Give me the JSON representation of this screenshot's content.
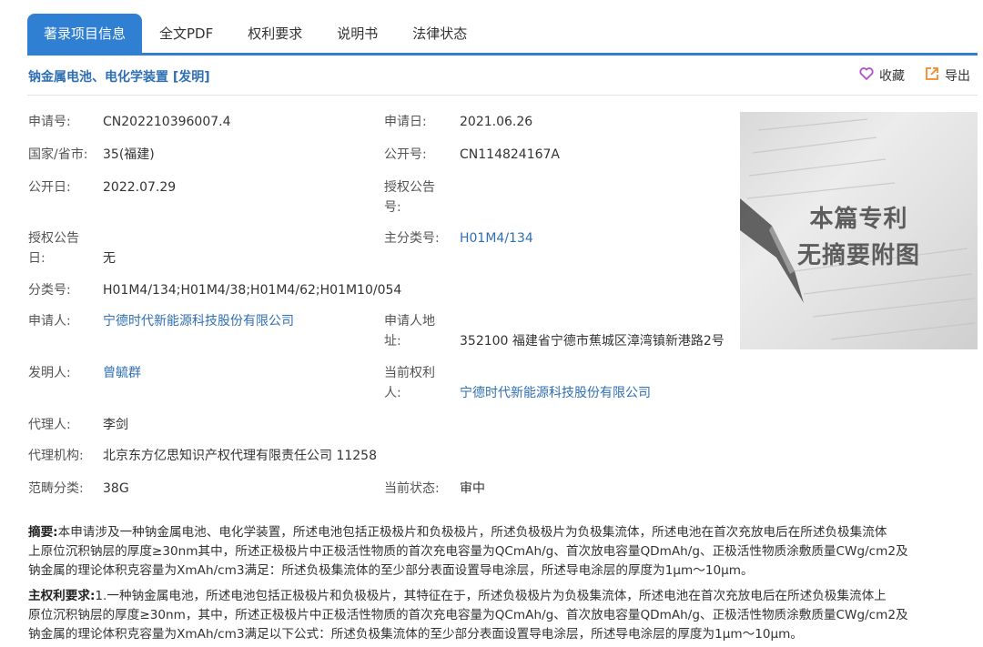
{
  "tabs": [
    {
      "label": "著录项目信息",
      "active": true
    },
    {
      "label": "全文PDF"
    },
    {
      "label": "权利要求"
    },
    {
      "label": "说明书"
    },
    {
      "label": "法律状态"
    }
  ],
  "title": "钠金属电池、电化学装置 [发明]",
  "actions": {
    "favorite": "收藏",
    "export": "导出"
  },
  "fields": {
    "app_no_label": "申请号:",
    "app_no": "CN202210396007.4",
    "app_date_label": "申请日:",
    "app_date": "2021.06.26",
    "country_label": "国家/省市:",
    "country": "35(福建)",
    "pub_no_label": "公开号:",
    "pub_no": "CN114824167A",
    "pub_date_label": "公开日:",
    "pub_date": "2022.07.29",
    "grant_no_label_1": "授权公告",
    "grant_no_label_2": "号:",
    "grant_date_label_1": "授权公告",
    "grant_date_label_2": "日:",
    "grant_date": "无",
    "main_class_label": "主分类号:",
    "main_class": "H01M4/134",
    "class_label": "分类号:",
    "class": "H01M4/134;H01M4/38;H01M4/62;H01M10/054",
    "applicant_label": "申请人:",
    "applicant": "宁德时代新能源科技股份有限公司",
    "address_label_1": "申请人地",
    "address_label_2": "址:",
    "address": "352100 福建省宁德市蕉城区漳湾镇新港路2号",
    "inventor_label": "发明人:",
    "inventor": "曾毓群",
    "holder_label_1": "当前权利",
    "holder_label_2": "人:",
    "holder": "宁德时代新能源科技股份有限公司",
    "agent_label": "代理人:",
    "agent": "李剑",
    "agency_label": "代理机构:",
    "agency": "北京东方亿思知识产权代理有限责任公司 11258",
    "category_label": "范畴分类:",
    "category": "38G",
    "status_label": "当前状态:",
    "status": "审中"
  },
  "thumbnail": {
    "line1": "本篇专利",
    "line2": "无摘要附图"
  },
  "abstract": {
    "label": "摘要:",
    "line1": "本申请涉及一种钠金属电池、电化学装置，所述电池包括正极极片和负极极片，所述负极极片为负极集流体，所述电池在首次充放电后在所述负极集流体",
    "line2": "上原位沉积钠层的厚度≥30nm其中，所述正极极片中正极活性物质的首次充电容量为QCmAh/g、首次放电容量QDmAh/g、正极活性物质涂敷质量CWg/cm2及",
    "line3": "钠金属的理论体积克容量为XmAh/cm3满足：所述负极集流体的至少部分表面设置导电涂层，所述导电涂层的厚度为1μm～10μm。"
  },
  "claims": {
    "label": "主权利要求:",
    "line1": "1.一种钠金属电池，所述电池包括正极极片和负极极片，其特征在于，所述负极极片为负极集流体，所述电池在首次充放电后在所述负极集流体上",
    "line2": "原位沉积钠层的厚度≥30nm，其中，所述正极极片中正极活性物质的首次充电容量为QCmAh/g、首次放电容量QDmAh/g、正极活性物质涂敷质量CWg/cm2及",
    "line3": "钠金属的理论体积克容量为XmAh/cm3满足以下公式：所述负极集流体的至少部分表面设置导电涂层，所述导电涂层的厚度为1μm～10μm。"
  },
  "colors": {
    "accent": "#2f7fd2",
    "link": "#2f6fb4",
    "favorite_icon": "#b04fc9",
    "export_icon": "#f08a2a"
  }
}
